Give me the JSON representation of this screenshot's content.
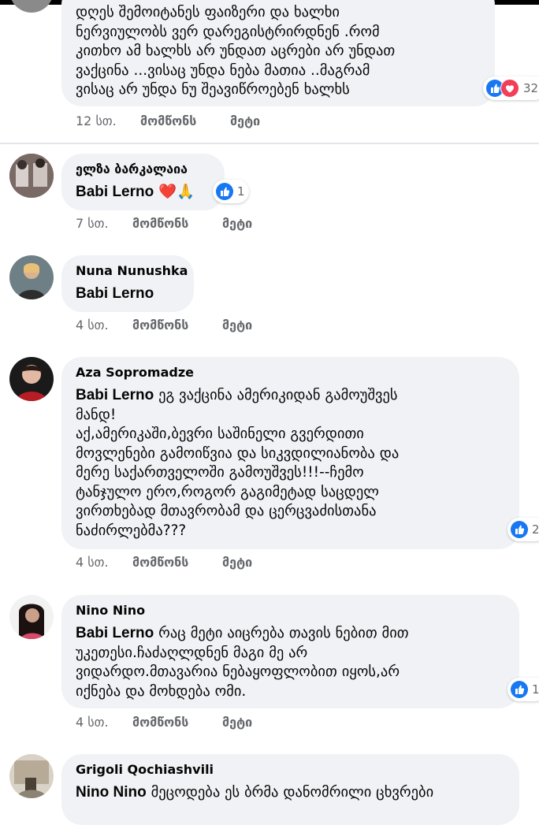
{
  "comments": [
    {
      "name": "",
      "lines": [
        "დღეს შემოიტანეს ფაიზერი და ხალხი",
        "ნერვიულობს ვერ დარეგისტრირდნენ .რომ",
        "კითხო ამ ხალხს არ უნდათ აცრები არ უნდათ",
        "ვაქცინა ...ვისაც უნდა ნება მათია ..მაგრამ",
        "ვისაც არ უნდა ნუ შეავიწროებენ ხალხს"
      ],
      "reactions": {
        "types": [
          "like-icon",
          "love-icon"
        ],
        "count": "32"
      },
      "time": "12 სთ.",
      "like": "მომწონს",
      "more": "მეტი"
    },
    {
      "name": "ელზა ბარკალაია",
      "mention": "Babi Lerno",
      "text": "❤️🙏",
      "reactions": {
        "types": [
          "like-icon"
        ],
        "count": "1"
      },
      "time": "7 სთ.",
      "like": "მომწონს",
      "more": "მეტი"
    },
    {
      "name": "Nuna Nunushka",
      "mention": "Babi Lerno",
      "time": "4 სთ.",
      "like": "მომწონს",
      "more": "მეტი"
    },
    {
      "name": "Aza Sopromadze",
      "mention": "Babi Lerno",
      "first_line": "ეგ ვაქცინა ამერიკიდან გამოუშვეს",
      "lines": [
        "მანდ!",
        "აქ,ამერიკაში,ბევრი საშინელი გვერდითი",
        "მოვლენები გამოიწვია და სიკვდილიანობა და",
        "მერე საქართველოში გამოუშვეს!!!--ჩემო",
        "ტანჯულო ერო,როგორ გაგიმეტად საცდელ",
        "ვირთხებად მთავრობამ და ცერცვაძისთანა",
        "ნაძირლებმა???"
      ],
      "reactions": {
        "types": [
          "like-icon"
        ],
        "count": "2"
      },
      "time": "4 სთ.",
      "like": "მომწონს",
      "more": "მეტი"
    },
    {
      "name": "Nino Nino",
      "mention": "Babi Lerno",
      "first_line": "რაც მეტი აიცრება თავის ნებით მით",
      "lines": [
        "უკეთესი.ჩაძაღლდნენ მაგი მე არ",
        "ვიდარდო.მთავარია ნებაყოფლობით იყოს,არ",
        "იქნება და მოხდება ომი."
      ],
      "reactions": {
        "types": [
          "like-icon"
        ],
        "count": "1"
      },
      "time": "4 სთ.",
      "like": "მომწონს",
      "more": "მეტი"
    },
    {
      "name": "Grigoli Qochiashvili",
      "mention": "Nino Nino",
      "first_line": "მეცოდება ეს ბრმა დანომრილი ცხვრები"
    }
  ],
  "colors": {
    "bubble": "#f0f2f5",
    "meta_text": "#65676b",
    "like_blue": "#1877f2",
    "love_red": "#f33e58"
  }
}
